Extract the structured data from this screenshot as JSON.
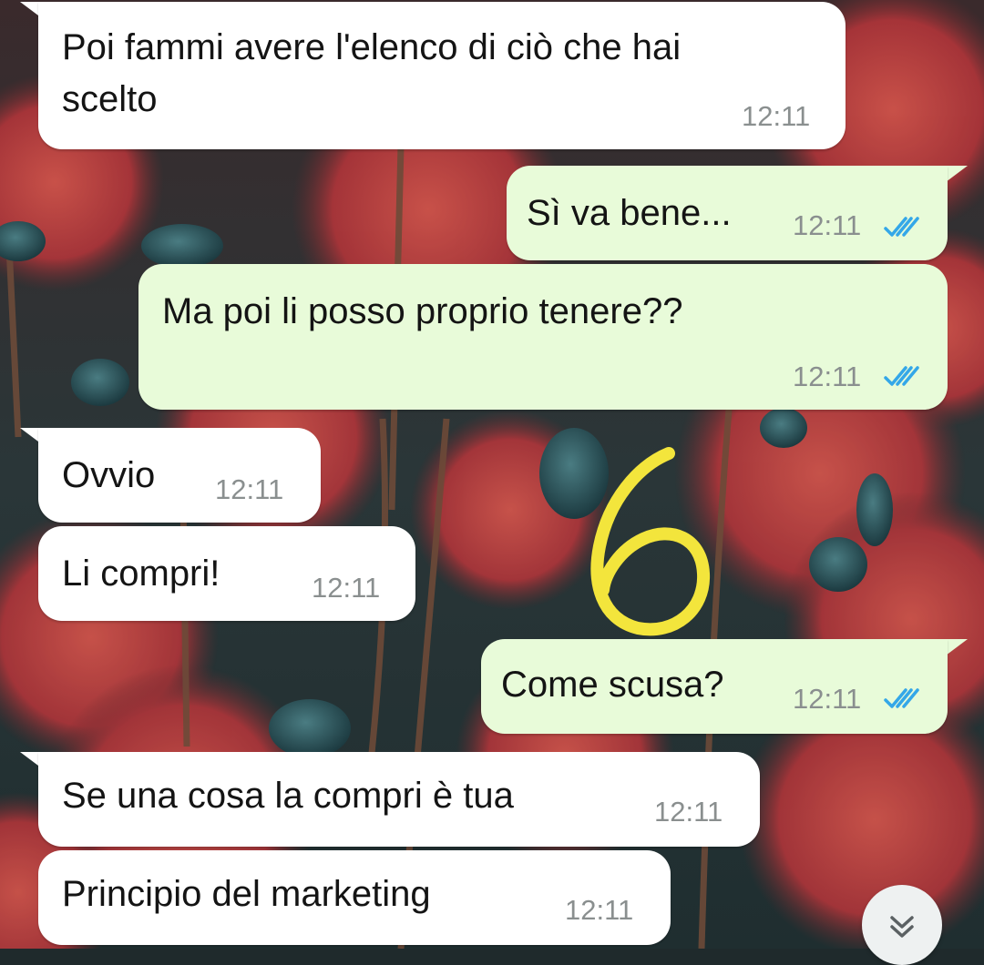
{
  "messages": [
    {
      "direction": "incoming",
      "text_lines": [
        "Poi fammi avere l'elenco di ciò che hai",
        "scelto"
      ],
      "time": "12:11"
    },
    {
      "direction": "outgoing",
      "text": "Sì va bene...",
      "time": "12:11",
      "status": "read"
    },
    {
      "direction": "outgoing",
      "text": "Ma poi li posso proprio tenere??",
      "time": "12:11",
      "status": "read"
    },
    {
      "direction": "incoming",
      "text": "Ovvio",
      "time": "12:11"
    },
    {
      "direction": "incoming",
      "text": "Li compri!",
      "time": "12:11"
    },
    {
      "direction": "outgoing",
      "text": "Come scusa?",
      "time": "12:11",
      "status": "read"
    },
    {
      "direction": "incoming",
      "text": "Se una cosa la compri è tua",
      "time": "12:11"
    },
    {
      "direction": "incoming",
      "text": "Principio del marketing",
      "time": "12:11"
    }
  ],
  "colors": {
    "incoming_bubble": "#ffffff",
    "outgoing_bubble": "#e8fbd9",
    "read_ticks": "#34a7e8",
    "annotation": "#f3e53c"
  },
  "icons": {
    "read_receipt": "double-check-icon",
    "scroll_down": "chevron-double-down-icon"
  }
}
